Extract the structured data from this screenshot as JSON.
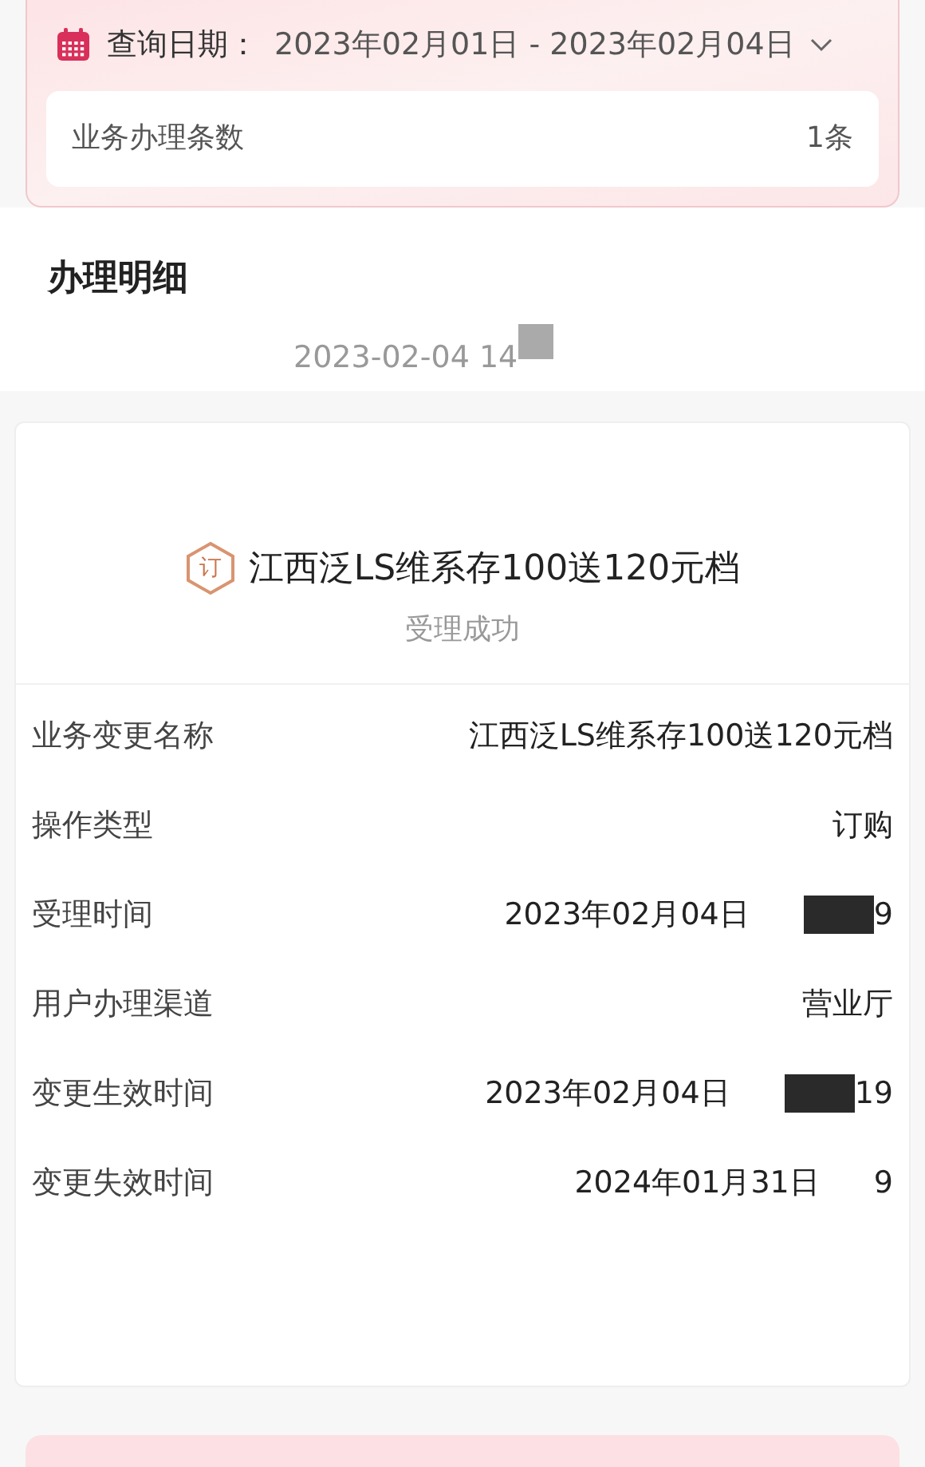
{
  "query": {
    "label": "查询日期：",
    "range": "2023年02月01日 - 2023年02月04日"
  },
  "summary": {
    "label": "业务办理条数",
    "value": "1条"
  },
  "section_title": "办理明细",
  "record_time": "2023-02-04 14",
  "record": {
    "badge": "订",
    "title": "江西泛LS维系存100送120元档",
    "status": "受理成功",
    "fields": [
      {
        "label": "业务变更名称",
        "value": "江西泛LS维系存100送120元档",
        "redacted": false
      },
      {
        "label": "操作类型",
        "value": "订购",
        "redacted": false
      },
      {
        "label": "受理时间",
        "date": "2023年02月04日",
        "value": "9",
        "redacted": true
      },
      {
        "label": "用户办理渠道",
        "value": "营业厅",
        "redacted": false
      },
      {
        "label": "变更生效时间",
        "date": "2023年02月04日",
        "value": "19",
        "redacted": true
      },
      {
        "label": "变更失效时间",
        "date": "2024年01月31日",
        "value": "9",
        "redacted": false
      }
    ]
  }
}
